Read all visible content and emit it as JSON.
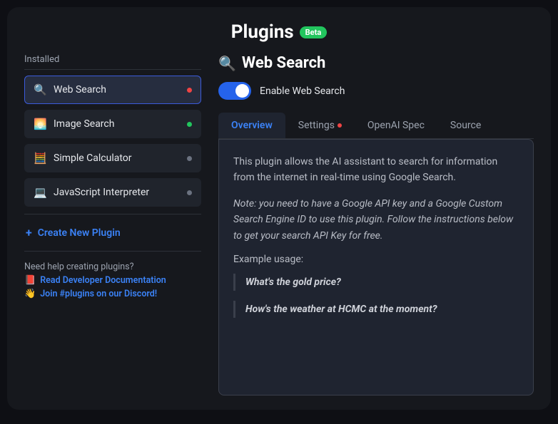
{
  "header": {
    "title": "Plugins",
    "badge": "Beta"
  },
  "sidebar": {
    "installed_label": "Installed",
    "plugins": [
      {
        "icon": "🔍",
        "name": "Web Search",
        "status": "red",
        "active": true
      },
      {
        "icon": "🌅",
        "name": "Image Search",
        "status": "green",
        "active": false
      },
      {
        "icon": "🧮",
        "name": "Simple Calculator",
        "status": "gray",
        "active": false
      },
      {
        "icon": "💻",
        "name": "JavaScript Interpreter",
        "status": "gray",
        "active": false
      }
    ],
    "create_label": "Create New Plugin",
    "help_text": "Need help creating plugins?",
    "doc_link": {
      "icon": "📕",
      "label": "Read Developer Documentation"
    },
    "discord_link": {
      "icon": "👋",
      "label": "Join #plugins on our Discord!"
    }
  },
  "content": {
    "icon": "🔍",
    "title": "Web Search",
    "toggle_label": "Enable Web Search",
    "tabs": [
      {
        "label": "Overview",
        "active": true,
        "dot": false
      },
      {
        "label": "Settings",
        "active": false,
        "dot": true
      },
      {
        "label": "OpenAI Spec",
        "active": false,
        "dot": false
      },
      {
        "label": "Source",
        "active": false,
        "dot": false
      }
    ],
    "overview": {
      "description": "This plugin allows the AI assistant to search for information from the internet in real-time using Google Search.",
      "note": "Note: you need to have a Google API key and a Google Custom Search Engine ID to use this plugin. Follow the instructions below to get your search API Key for free.",
      "example_label": "Example usage:",
      "examples": [
        "What's the gold price?",
        "How's the weather at HCMC at the moment?"
      ]
    }
  }
}
